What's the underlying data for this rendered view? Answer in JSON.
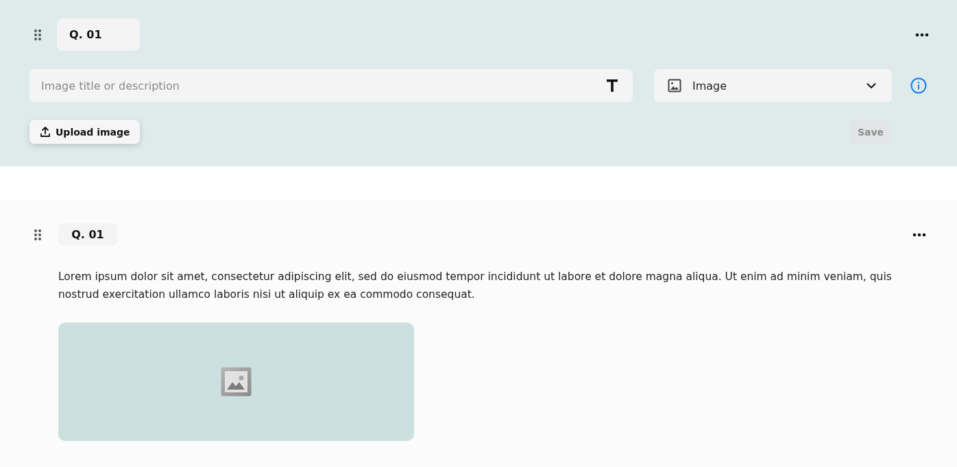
{
  "editor": {
    "question_label": "Q. 01",
    "title_field": {
      "placeholder": "Image title or description"
    },
    "type_select": {
      "value": "Image"
    },
    "upload_button": "Upload image",
    "save_button": {
      "label": "Save",
      "disabled": true
    }
  },
  "preview": {
    "question_label": "Q. 01",
    "text": "Lorem ipsum dolor sit amet, consectetur adipiscing elit, sed do eiusmod tempor incididunt ut labore et dolore magna aliqua. Ut enim ad minim veniam, quis nostrud exercitation ullamco laboris nisi ut aliquip ex ea commodo consequat."
  }
}
